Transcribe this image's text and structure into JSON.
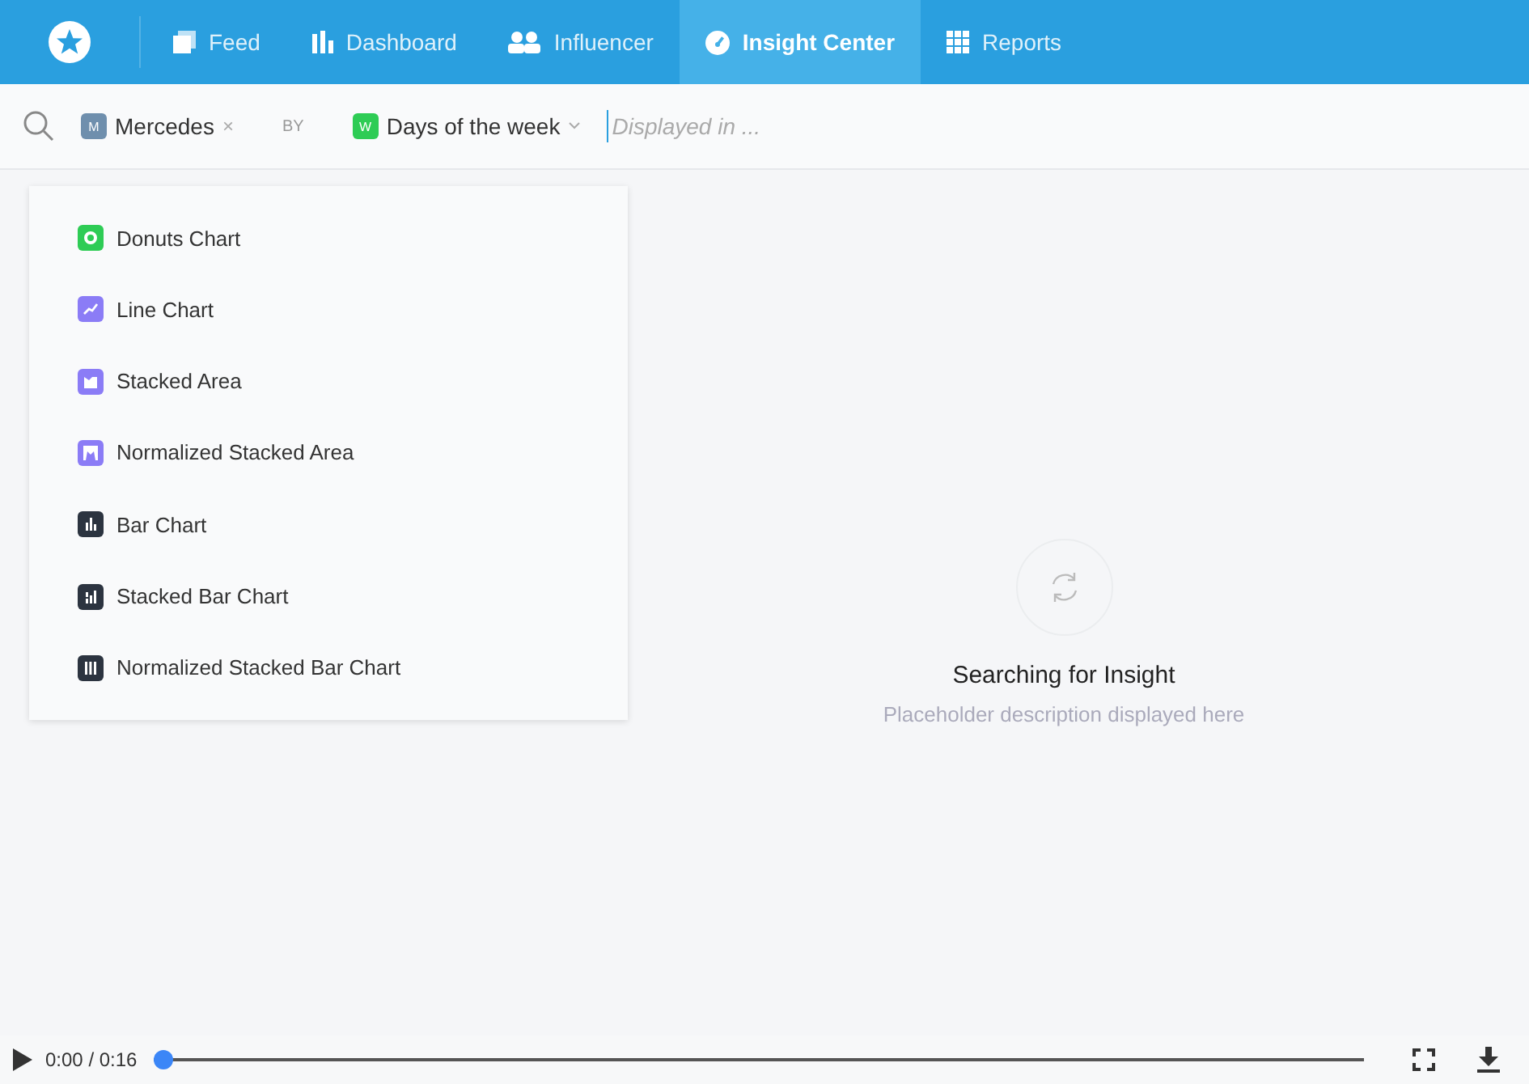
{
  "nav": {
    "tabs": [
      {
        "label": "Feed",
        "kind": "feed",
        "selected": false
      },
      {
        "label": "Dashboard",
        "kind": "dashboard",
        "selected": false
      },
      {
        "label": "Influencer",
        "kind": "influencer",
        "selected": false
      },
      {
        "label": "Insight Center",
        "kind": "insight",
        "selected": true
      },
      {
        "label": "Reports",
        "kind": "reports",
        "selected": false
      }
    ]
  },
  "query": {
    "subject": {
      "badge": "M",
      "label": "Mercedes",
      "remove": "×"
    },
    "by": "BY",
    "dimension": {
      "badge": "W",
      "label": "Days of the week"
    },
    "placeholder": "Displayed in ..."
  },
  "chart_menu": [
    {
      "label": "Donuts Chart",
      "kind": "donut",
      "color": "#2ecc55"
    },
    {
      "label": "Line Chart",
      "kind": "line",
      "color": "#8b7cf6"
    },
    {
      "label": "Stacked Area",
      "kind": "area",
      "color": "#8b7cf6"
    },
    {
      "label": "Normalized Stacked Area",
      "kind": "normalized-area",
      "color": "#8b7cf6"
    },
    {
      "label": "Bar Chart",
      "kind": "bar",
      "color": "#2c3440"
    },
    {
      "label": "Stacked Bar Chart",
      "kind": "stacked-bar",
      "color": "#2c3440"
    },
    {
      "label": "Normalized Stacked Bar Chart",
      "kind": "normalized-bar",
      "color": "#2c3440"
    }
  ],
  "empty_state": {
    "title": "Searching for Insight",
    "description": "Placeholder description displayed here"
  },
  "player": {
    "time": "0:00 / 0:16",
    "level": 0
  }
}
